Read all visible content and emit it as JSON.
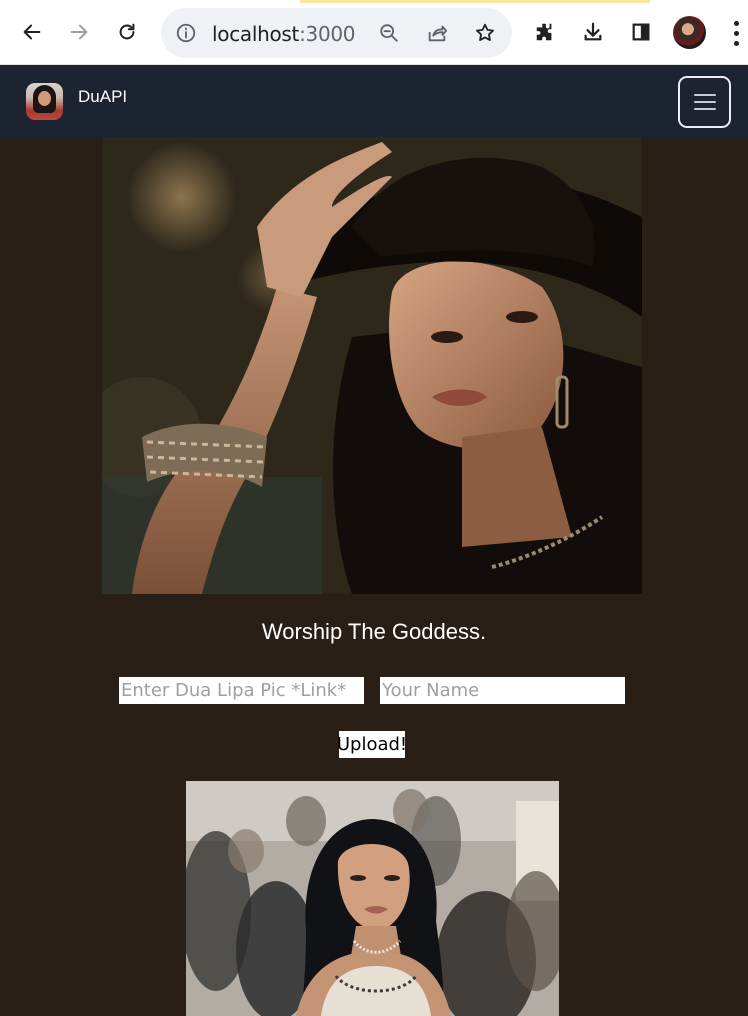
{
  "browser": {
    "url_host": "localhost",
    "url_port": ":3000",
    "icons": [
      "back-icon",
      "forward-icon",
      "reload-icon",
      "info-icon",
      "zoom-out-icon",
      "share-icon",
      "star-icon",
      "extensions-icon",
      "download-icon",
      "side-panel-icon",
      "profile-avatar",
      "more-icon"
    ]
  },
  "navbar": {
    "brand": "DuAPI",
    "menu_icon": "hamburger-menu-icon"
  },
  "main": {
    "heading": "Worship The Goddess.",
    "link_placeholder": "Enter Dua Lipa Pic *Link*",
    "name_placeholder": "Your Name",
    "upload_label": "Upload!"
  },
  "colors": {
    "page_bg": "#2a1f16",
    "navbar_bg": "#1c2331",
    "text": "#ffffff"
  }
}
